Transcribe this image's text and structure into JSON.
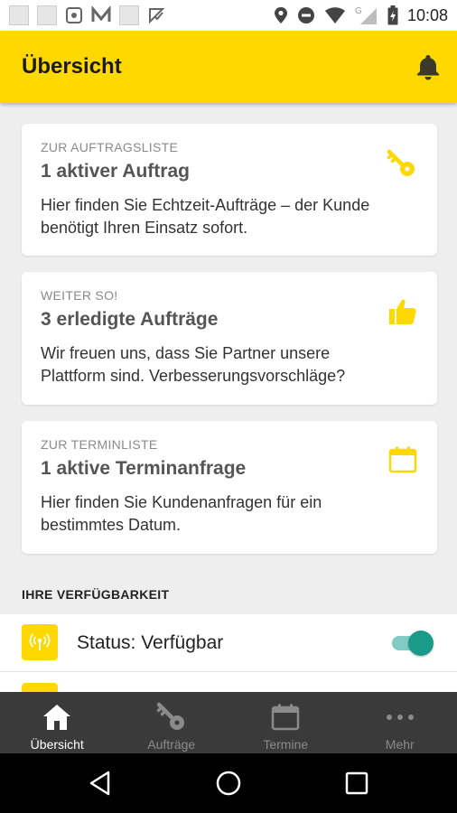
{
  "status_bar": {
    "time": "10:08",
    "left_icons": [
      "image-icon",
      "image-icon",
      "app-icon",
      "app-icon",
      "app-icon",
      "app-icon"
    ],
    "right_icons": [
      "location-icon",
      "dnd-icon",
      "wifi-icon",
      "signal-icon",
      "battery-icon"
    ]
  },
  "app_bar": {
    "title": "Übersicht",
    "bell_icon": "bell-icon"
  },
  "cards": [
    {
      "eyebrow": "ZUR AUFTRAGSLISTE",
      "title": "1 aktiver Auftrag",
      "text": "Hier finden Sie Echtzeit-Aufträge – der Kunde benötigt Ihren Einsatz sofort.",
      "icon": "key-icon"
    },
    {
      "eyebrow": "WEITER SO!",
      "title": "3 erledigte Aufträge",
      "text": "Wir freuen uns, dass Sie Partner unsere Plattform sind. Verbesserungsvorschläge?",
      "icon": "thumbs-up-icon"
    },
    {
      "eyebrow": "ZUR TERMINLISTE",
      "title": "1 aktive Terminanfrage",
      "text": "Hier finden Sie Kundenanfragen für ein bestimmtes Datum.",
      "icon": "calendar-icon"
    }
  ],
  "availability": {
    "section_label": "IHRE VERFÜGBARKEIT",
    "status_text": "Status: Verfügbar",
    "toggle_on": true,
    "icon": "broadcast-icon"
  },
  "bottom_nav": [
    {
      "label": "Übersicht",
      "icon": "home-icon",
      "active": true
    },
    {
      "label": "Aufträge",
      "icon": "key-icon",
      "active": false
    },
    {
      "label": "Termine",
      "icon": "calendar-icon",
      "active": false
    },
    {
      "label": "Mehr",
      "icon": "more-icon",
      "active": false
    }
  ],
  "colors": {
    "accent": "#ffd800",
    "toggle_on": "#1a9a89",
    "nav_bg": "#3a3a3a",
    "nav_inactive": "#8a8a8a"
  }
}
